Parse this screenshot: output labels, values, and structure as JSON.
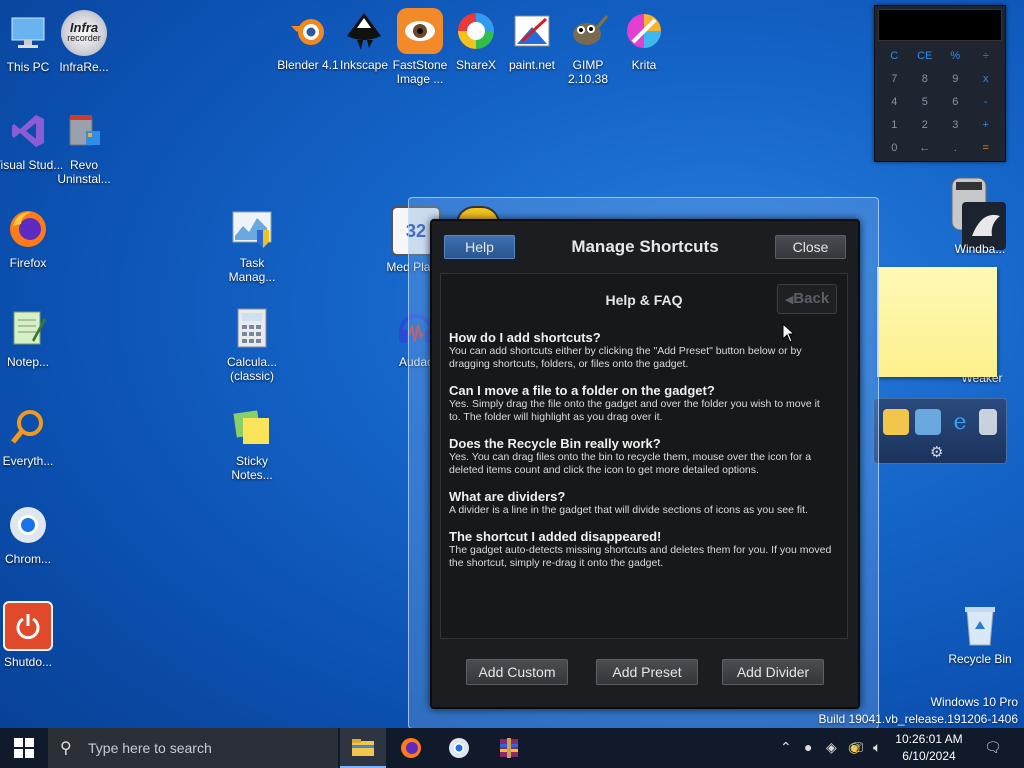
{
  "desktop": {
    "icons": [
      {
        "label": "This PC"
      },
      {
        "label": "InfraRe..."
      },
      {
        "label": "Visual Stud..."
      },
      {
        "label": "Revo Uninstal..."
      },
      {
        "label": "Firefox"
      },
      {
        "label": "Notep..."
      },
      {
        "label": "Everyth..."
      },
      {
        "label": "Chrom..."
      },
      {
        "label": "Shutdo..."
      },
      {
        "label": "Blender 4.1"
      },
      {
        "label": "Inkscape"
      },
      {
        "label": "FastStone Image ..."
      },
      {
        "label": "ShareX"
      },
      {
        "label": "paint.net"
      },
      {
        "label": "GIMP 2.10.38"
      },
      {
        "label": "Krita"
      },
      {
        "label": "Task Manag..."
      },
      {
        "label": "Calcula... (classic)"
      },
      {
        "label": "Sticky Notes..."
      },
      {
        "label": "Med Play..."
      },
      {
        "label": "Audac"
      },
      {
        "label": "Windba..."
      },
      {
        "label": "Weaker"
      },
      {
        "label": "Recycle Bin"
      }
    ],
    "infra_logo_text": "Infra",
    "infra_logo_sub": "recorder",
    "media_badge": "32"
  },
  "calculator": {
    "keys": [
      "C",
      "CE",
      "%",
      "÷",
      "7",
      "8",
      "9",
      "x",
      "4",
      "5",
      "6",
      "-",
      "1",
      "2",
      "3",
      "+",
      "0",
      "←",
      ".",
      "="
    ]
  },
  "dialog": {
    "title": "Manage Shortcuts",
    "help_label": "Help",
    "close_label": "Close",
    "section_title": "Help & FAQ",
    "back_label": "Back",
    "faq": [
      {
        "q": "How do I add shortcuts?",
        "a": "You can add shortcuts either by clicking the \"Add Preset\" button below or by dragging shortcuts, folders, or files onto the gadget."
      },
      {
        "q": "Can I move a file to a folder on the gadget?",
        "a": "Yes. Simply drag the file onto the gadget and over the folder you wish to move it to. The folder will highlight as you drag over it."
      },
      {
        "q": "Does the Recycle Bin really work?",
        "a": "Yes. You can drag files onto the bin to recycle them, mouse over the icon for a deleted items count and click the icon to get more detailed options."
      },
      {
        "q": "What are dividers?",
        "a": "A divider is a line in the gadget that will divide sections of icons as you see fit."
      },
      {
        "q": "The shortcut I added disappeared!",
        "a": "The gadget auto-detects missing shortcuts and deletes them for you. If you moved the shortcut, simply re-drag it onto the gadget."
      }
    ],
    "add_custom_label": "Add Custom",
    "add_preset_label": "Add Preset",
    "add_divider_label": "Add Divider"
  },
  "taskbar": {
    "search_placeholder": "Type here to search",
    "time": "10:26:01 AM",
    "date": "6/10/2024"
  },
  "watermark": {
    "edition": "Windows 10 Pro",
    "build": "Build 19041.vb_release.191206-1406"
  }
}
